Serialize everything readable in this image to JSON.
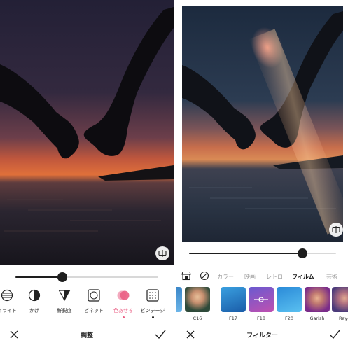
{
  "left_screen": {
    "slider": {
      "value": 0.33
    },
    "tools": [
      {
        "label": "イライト",
        "icon": "highlight-icon"
      },
      {
        "label": "かげ",
        "icon": "shadow-icon"
      },
      {
        "label": "鮮鋭度",
        "icon": "sharpness-icon"
      },
      {
        "label": "ビネット",
        "icon": "vignette-icon"
      },
      {
        "label": "色あせる",
        "icon": "fade-icon",
        "selected": true
      },
      {
        "label": "ビンテージ",
        "icon": "vintage-icon"
      }
    ],
    "bottom": {
      "title": "調整"
    }
  },
  "right_screen": {
    "slider": {
      "value": 0.77
    },
    "categories": [
      "カラー",
      "映画",
      "レトロ",
      "フィルム",
      "芸術"
    ],
    "selected_category": "フィルム",
    "filters": [
      {
        "label": ""
      },
      {
        "label": "C16"
      },
      {
        "label": "F17"
      },
      {
        "label": "F18"
      },
      {
        "label": "F20"
      },
      {
        "label": "Garish"
      },
      {
        "label": "Raye"
      }
    ],
    "bottom": {
      "title": "フィルター"
    }
  },
  "colors": {
    "accent_pink": "#ea5d83",
    "dark": "#1e1e1e",
    "muted_text": "#9c9c9c"
  }
}
